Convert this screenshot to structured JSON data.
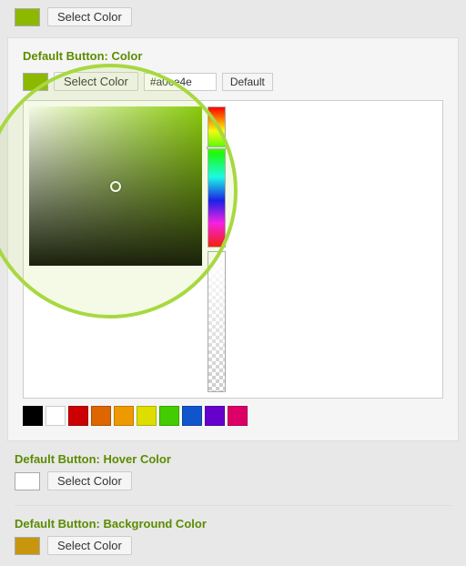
{
  "top_row": {
    "swatch_color": "#8db800",
    "button_label": "Select Color"
  },
  "main_panel": {
    "title": "Default Button: Color",
    "select_color_label": "Select Color",
    "swatch_color": "#8db800",
    "hex_value": "#a0ce4e",
    "default_btn_label": "Default",
    "swatches": [
      {
        "color": "#000000"
      },
      {
        "color": "#ffffff"
      },
      {
        "color": "#cc0000"
      },
      {
        "color": "#dd6600"
      },
      {
        "color": "#ee9900"
      },
      {
        "color": "#dddd00"
      },
      {
        "color": "#44cc00"
      },
      {
        "color": "#1155cc"
      },
      {
        "color": "#6600cc"
      },
      {
        "color": "#dd0066"
      }
    ]
  },
  "hover_section": {
    "title": "Default Button: Hover Color",
    "button_label": "Select Color",
    "swatch_color": "#ffffff"
  },
  "background_section": {
    "title": "Default Button: Background Color",
    "button_label": "Select Color",
    "swatch_color": "#c8960c"
  }
}
